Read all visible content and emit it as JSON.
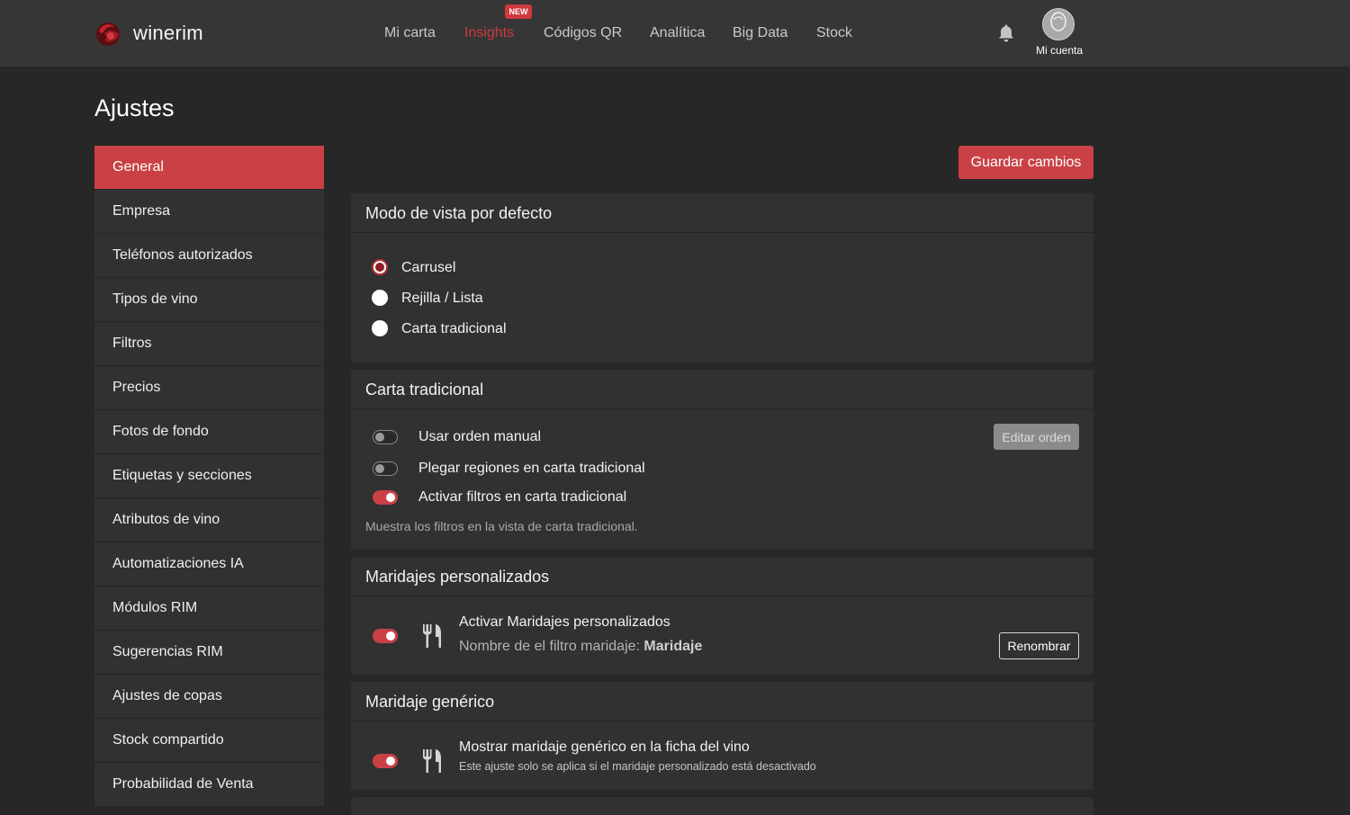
{
  "app": {
    "brand": "winerim",
    "nav": [
      {
        "label": "Mi carta",
        "active": false
      },
      {
        "label": "Insights",
        "active": true
      },
      {
        "label": "Códigos QR",
        "active": false
      },
      {
        "label": "Analítica",
        "active": false
      },
      {
        "label": "Big Data",
        "active": false
      },
      {
        "label": "Stock",
        "active": false
      }
    ],
    "new_badge": "NEW",
    "account_label": "Mi cuenta",
    "colors": {
      "accent": "#c94145",
      "background": "#272727",
      "topbar": "#363636",
      "card": "#313131"
    }
  },
  "page": {
    "title": "Ajustes",
    "save_label": "Guardar cambios"
  },
  "sidebar": {
    "items": [
      {
        "label": "General",
        "active": true
      },
      {
        "label": "Empresa"
      },
      {
        "label": "Teléfonos autorizados"
      },
      {
        "label": "Tipos de vino"
      },
      {
        "label": "Filtros"
      },
      {
        "label": "Precios"
      },
      {
        "label": "Fotos de fondo"
      },
      {
        "label": "Etiquetas y secciones"
      },
      {
        "label": "Atributos de vino"
      },
      {
        "label": "Automatizaciones IA"
      },
      {
        "label": "Módulos RIM"
      },
      {
        "label": "Sugerencias RIM"
      },
      {
        "label": "Ajustes de copas"
      },
      {
        "label": "Stock compartido"
      },
      {
        "label": "Probabilidad de Venta"
      }
    ]
  },
  "view_mode": {
    "title": "Modo de vista por defecto",
    "options": [
      {
        "label": "Carrusel",
        "selected": true
      },
      {
        "label": "Rejilla / Lista",
        "selected": false
      },
      {
        "label": "Carta tradicional",
        "selected": false
      }
    ]
  },
  "traditional": {
    "title": "Carta tradicional",
    "manual_order": {
      "label": "Usar orden manual",
      "on": false,
      "button": "Editar orden"
    },
    "fold_regions": {
      "label": "Plegar regiones en carta tradicional",
      "on": false
    },
    "filters": {
      "label": "Activar filtros en carta tradicional",
      "on": true
    },
    "help": "Muestra los filtros en la vista de carta tradicional."
  },
  "custom_pairings": {
    "title": "Maridajes personalizados",
    "toggle_on": true,
    "icon": "cutlery-icon",
    "label": "Activar Maridajes personalizados",
    "filter_name_prefix": "Nombre de el filtro maridaje:",
    "filter_name_value": "Maridaje",
    "rename_button": "Renombrar"
  },
  "generic_pairing": {
    "title": "Maridaje genérico",
    "toggle_on": true,
    "icon": "cutlery-icon",
    "label": "Mostrar maridaje genérico en la ficha del vino",
    "help": "Este ajuste solo se aplica si el maridaje personalizado está desactivado"
  }
}
